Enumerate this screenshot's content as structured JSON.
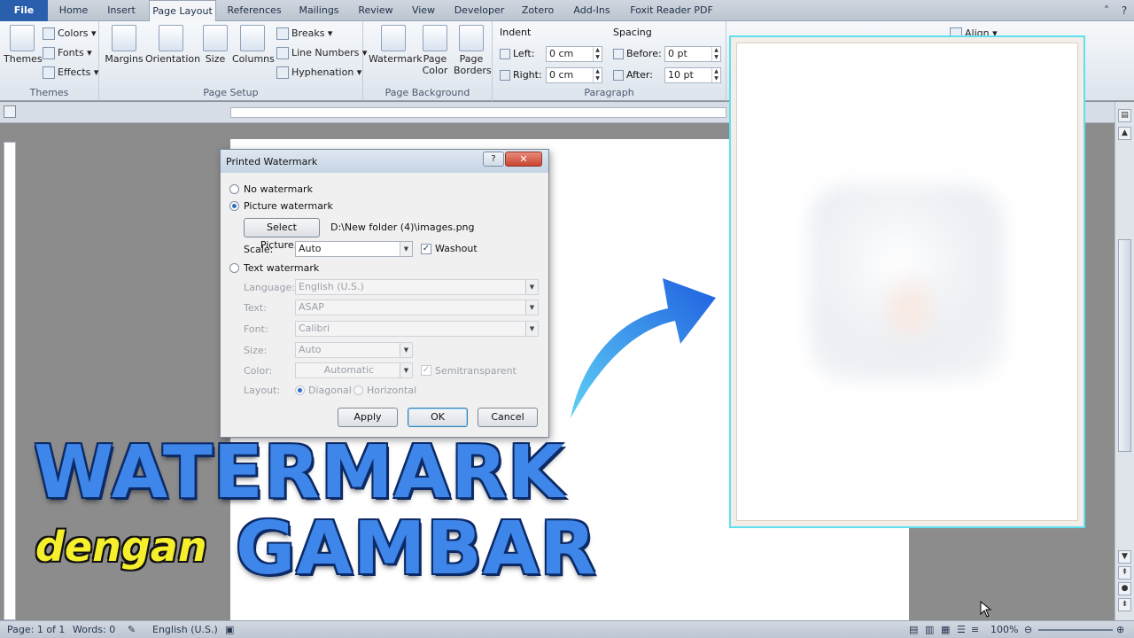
{
  "tabs": [
    "File",
    "Home",
    "Insert",
    "Page Layout",
    "References",
    "Mailings",
    "Review",
    "View",
    "Developer",
    "Zotero",
    "Add-Ins",
    "Foxit Reader PDF"
  ],
  "active_tab": "Page Layout",
  "ribbon": {
    "themes": {
      "big": "Themes",
      "colors": "Colors",
      "fonts": "Fonts",
      "effects": "Effects",
      "group": "Themes"
    },
    "page_setup": {
      "margins": "Margins",
      "orientation": "Orientation",
      "size": "Size",
      "columns": "Columns",
      "breaks": "Breaks",
      "line_numbers": "Line Numbers",
      "hyphenation": "Hyphenation",
      "group": "Page Setup"
    },
    "page_background": {
      "watermark": "Watermark",
      "page_color_1": "Page",
      "page_color_2": "Color",
      "page_borders_1": "Page",
      "page_borders_2": "Borders",
      "group": "Page Background"
    },
    "paragraph": {
      "indent": "Indent",
      "left_label": "Left:",
      "left_value": "0 cm",
      "right_label": "Right:",
      "right_value": "0 cm",
      "spacing": "Spacing",
      "before_label": "Before:",
      "before_value": "0 pt",
      "after_label": "After:",
      "after_value": "10 pt",
      "group": "Paragraph"
    },
    "arrange": {
      "align": "Align"
    }
  },
  "dialog": {
    "title": "Printed Watermark",
    "help": "?",
    "no_watermark": "No watermark",
    "picture_watermark": "Picture watermark",
    "select_picture": "Select Picture...",
    "picture_path": "D:\\New folder (4)\\images.png",
    "scale_label": "Scale:",
    "scale_value": "Auto",
    "washout": "Washout",
    "text_watermark": "Text watermark",
    "language_label": "Language:",
    "language_value": "English (U.S.)",
    "text_label": "Text:",
    "text_value": "ASAP",
    "font_label": "Font:",
    "font_value": "Calibri",
    "size_label": "Size:",
    "size_value": "Auto",
    "color_label": "Color:",
    "color_value": "Automatic",
    "semitransparent": "Semitransparent",
    "layout_label": "Layout:",
    "diagonal": "Diagonal",
    "horizontal": "Horizontal",
    "apply": "Apply",
    "ok": "OK",
    "cancel": "Cancel"
  },
  "overlay": {
    "line1": "WATERMARK",
    "connector": "dengan",
    "line2": "GAMBAR",
    "arrow_color": "#2f78e6"
  },
  "status": {
    "page": "Page: 1 of 1",
    "words": "Words: 0",
    "language": "English (U.S.)",
    "zoom": "100%"
  }
}
